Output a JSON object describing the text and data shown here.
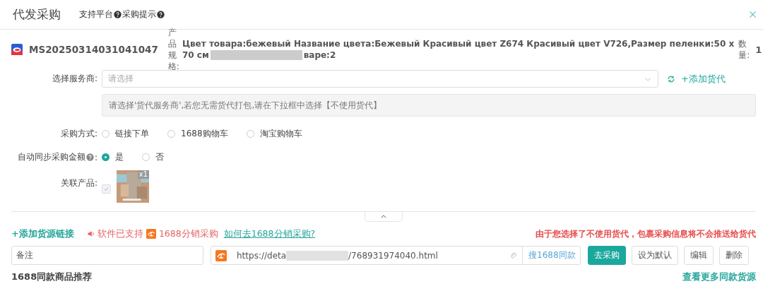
{
  "dialog": {
    "title": "代发采购",
    "header_links": [
      {
        "label": "支持平台"
      },
      {
        "label": "采购提示"
      }
    ]
  },
  "order": {
    "id": "MS20250314031041047",
    "spec_label": "产品规格:",
    "spec_text": "Цвет товара:бежевый Название цвета:Бежевый Красивый цвет Z674 Красивый цвет V726,Размер пеленки:50 x",
    "spec_line2": "70 см",
    "spec_tail": "варе:2",
    "quantity_label": "数量:",
    "quantity": "1"
  },
  "form": {
    "service_provider": {
      "label": "选择服务商:",
      "placeholder": "请选择",
      "add_link": "+添加货代"
    },
    "notice": "请选择'货代服务商',若您无需货代打包,请在下拉框中选择【不使用货代】",
    "purchase_method": {
      "label": "采购方式:",
      "options": [
        {
          "label": "链接下单",
          "selected": false
        },
        {
          "label": "1688购物车",
          "selected": false
        },
        {
          "label": "淘宝购物车",
          "selected": false
        }
      ]
    },
    "auto_sync": {
      "label": "自动同步采购金额",
      "colon": ":",
      "options": [
        {
          "label": "是",
          "selected": true
        },
        {
          "label": "否",
          "selected": false
        }
      ]
    },
    "related_product": {
      "label": "关联产品:",
      "checked": true,
      "disabled": true,
      "badge": "x1"
    }
  },
  "source": {
    "add_link": "+添加货源链接",
    "support_text": "软件已支持",
    "platform": "1688分销采购",
    "help_link": "如何去1688分销采购?",
    "warning": "由于您选择了不使用货代，包裹采购信息将不会推送给货代",
    "remark": "备注",
    "url_start": "https://deta",
    "url_end": "/768931974040.html",
    "buttons": [
      {
        "label": "搜1688同款",
        "kind": "search"
      },
      {
        "label": "去采购",
        "kind": "primary"
      },
      {
        "label": "设为默认",
        "kind": "default"
      },
      {
        "label": "编辑",
        "kind": "default"
      },
      {
        "label": "删除",
        "kind": "default"
      }
    ]
  },
  "recommend": {
    "title": "1688同款商品推荐",
    "more_link": "查看更多同款货源"
  }
}
